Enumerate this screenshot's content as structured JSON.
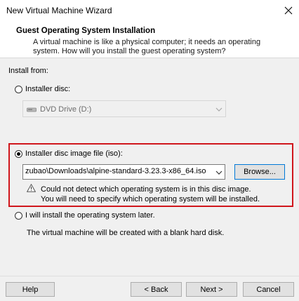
{
  "window": {
    "title": "New Virtual Machine Wizard"
  },
  "header": {
    "title": "Guest Operating System Installation",
    "description_line1": "A virtual machine is like a physical computer; it needs an operating",
    "description_line2": "system. How will you install the guest operating system?"
  },
  "install_from": {
    "label": "Install from:",
    "installer_disc": {
      "label": "Installer disc:",
      "selected": false,
      "drive_value": "DVD Drive (D:)"
    },
    "iso": {
      "label": "Installer disc image file (iso):",
      "selected": true,
      "path_value": "zubao\\Downloads\\alpine-standard-3.23.3-x86_64.iso",
      "browse_label": "Browse...",
      "warning_line1": "Could not detect which operating system is in this disc image.",
      "warning_line2": "You will need to specify which operating system will be installed."
    },
    "later": {
      "label": "I will install the operating system later.",
      "selected": false,
      "description": "The virtual machine will be created with a blank hard disk."
    }
  },
  "footer": {
    "help_label": "Help",
    "back_label": "< Back",
    "next_label": "Next >",
    "cancel_label": "Cancel"
  },
  "colors": {
    "highlight_border": "#d0161c",
    "focus_border": "#0078d7"
  }
}
